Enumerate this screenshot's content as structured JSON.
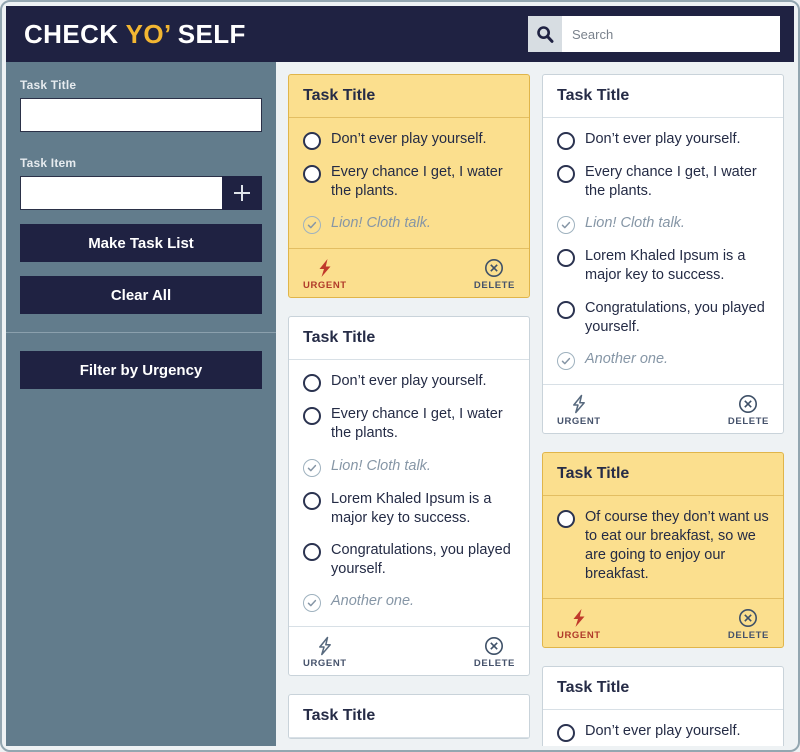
{
  "header": {
    "logo_part1": "CHECK ",
    "logo_accent": "YO’",
    "logo_part2": " SELF",
    "search_icon": "search-icon",
    "search_value": "",
    "search_placeholder": "Search"
  },
  "sidebar": {
    "task_title_label": "Task Title",
    "task_title_value": "",
    "task_title_placeholder": "",
    "task_item_label": "Task Item",
    "task_item_value": "",
    "task_item_placeholder": "",
    "add_icon": "plus-icon",
    "make_list_label": "Make Task List",
    "clear_all_label": "Clear All",
    "filter_label": "Filter by Urgency"
  },
  "board": {
    "urgent_label": "URGENT",
    "delete_label": "DELETE",
    "urgent_icon": "lightning-bolt-icon",
    "delete_icon": "circle-x-icon",
    "colors": {
      "navy": "#1f2242",
      "slate": "#627c8c",
      "yellow": "#fbdf8e",
      "yellow_border": "#e0b54a",
      "accent_gold": "#f2b632",
      "urgent_red": "#b03a2a",
      "page_bg": "#eef2f4"
    },
    "columns": [
      {
        "cards": [
          {
            "title": "Task Title",
            "urgent": true,
            "tasks": [
              {
                "text": "Don’t ever play yourself.",
                "done": false
              },
              {
                "text": "Every chance I get, I water the plants.",
                "done": false
              },
              {
                "text": "Lion! Cloth talk.",
                "done": true
              }
            ]
          },
          {
            "title": "Task Title",
            "urgent": false,
            "tasks": [
              {
                "text": "Don’t ever play yourself.",
                "done": false
              },
              {
                "text": "Every chance I get, I water the plants.",
                "done": false
              },
              {
                "text": "Lion! Cloth talk.",
                "done": true
              },
              {
                "text": "Lorem Khaled Ipsum is a major key to success.",
                "done": false
              },
              {
                "text": "Congratulations, you played yourself.",
                "done": false
              },
              {
                "text": "Another one.",
                "done": true
              }
            ]
          },
          {
            "title": "Task Title",
            "urgent": false,
            "tasks": []
          }
        ]
      },
      {
        "cards": [
          {
            "title": "Task Title",
            "urgent": false,
            "tasks": [
              {
                "text": "Don’t ever play yourself.",
                "done": false
              },
              {
                "text": "Every chance I get, I water the plants.",
                "done": false
              },
              {
                "text": "Lion! Cloth talk.",
                "done": true
              },
              {
                "text": "Lorem Khaled Ipsum is a major key to success.",
                "done": false
              },
              {
                "text": "Congratulations, you played yourself.",
                "done": false
              },
              {
                "text": "Another one.",
                "done": true
              }
            ]
          },
          {
            "title": "Task Title",
            "urgent": true,
            "tasks": [
              {
                "text": "Of course they don’t want us to eat our breakfast, so we are going to enjoy our breakfast.",
                "done": false
              }
            ]
          },
          {
            "title": "Task Title",
            "urgent": false,
            "tasks": [
              {
                "text": "Don’t ever play yourself.",
                "done": false
              }
            ]
          }
        ]
      }
    ]
  }
}
